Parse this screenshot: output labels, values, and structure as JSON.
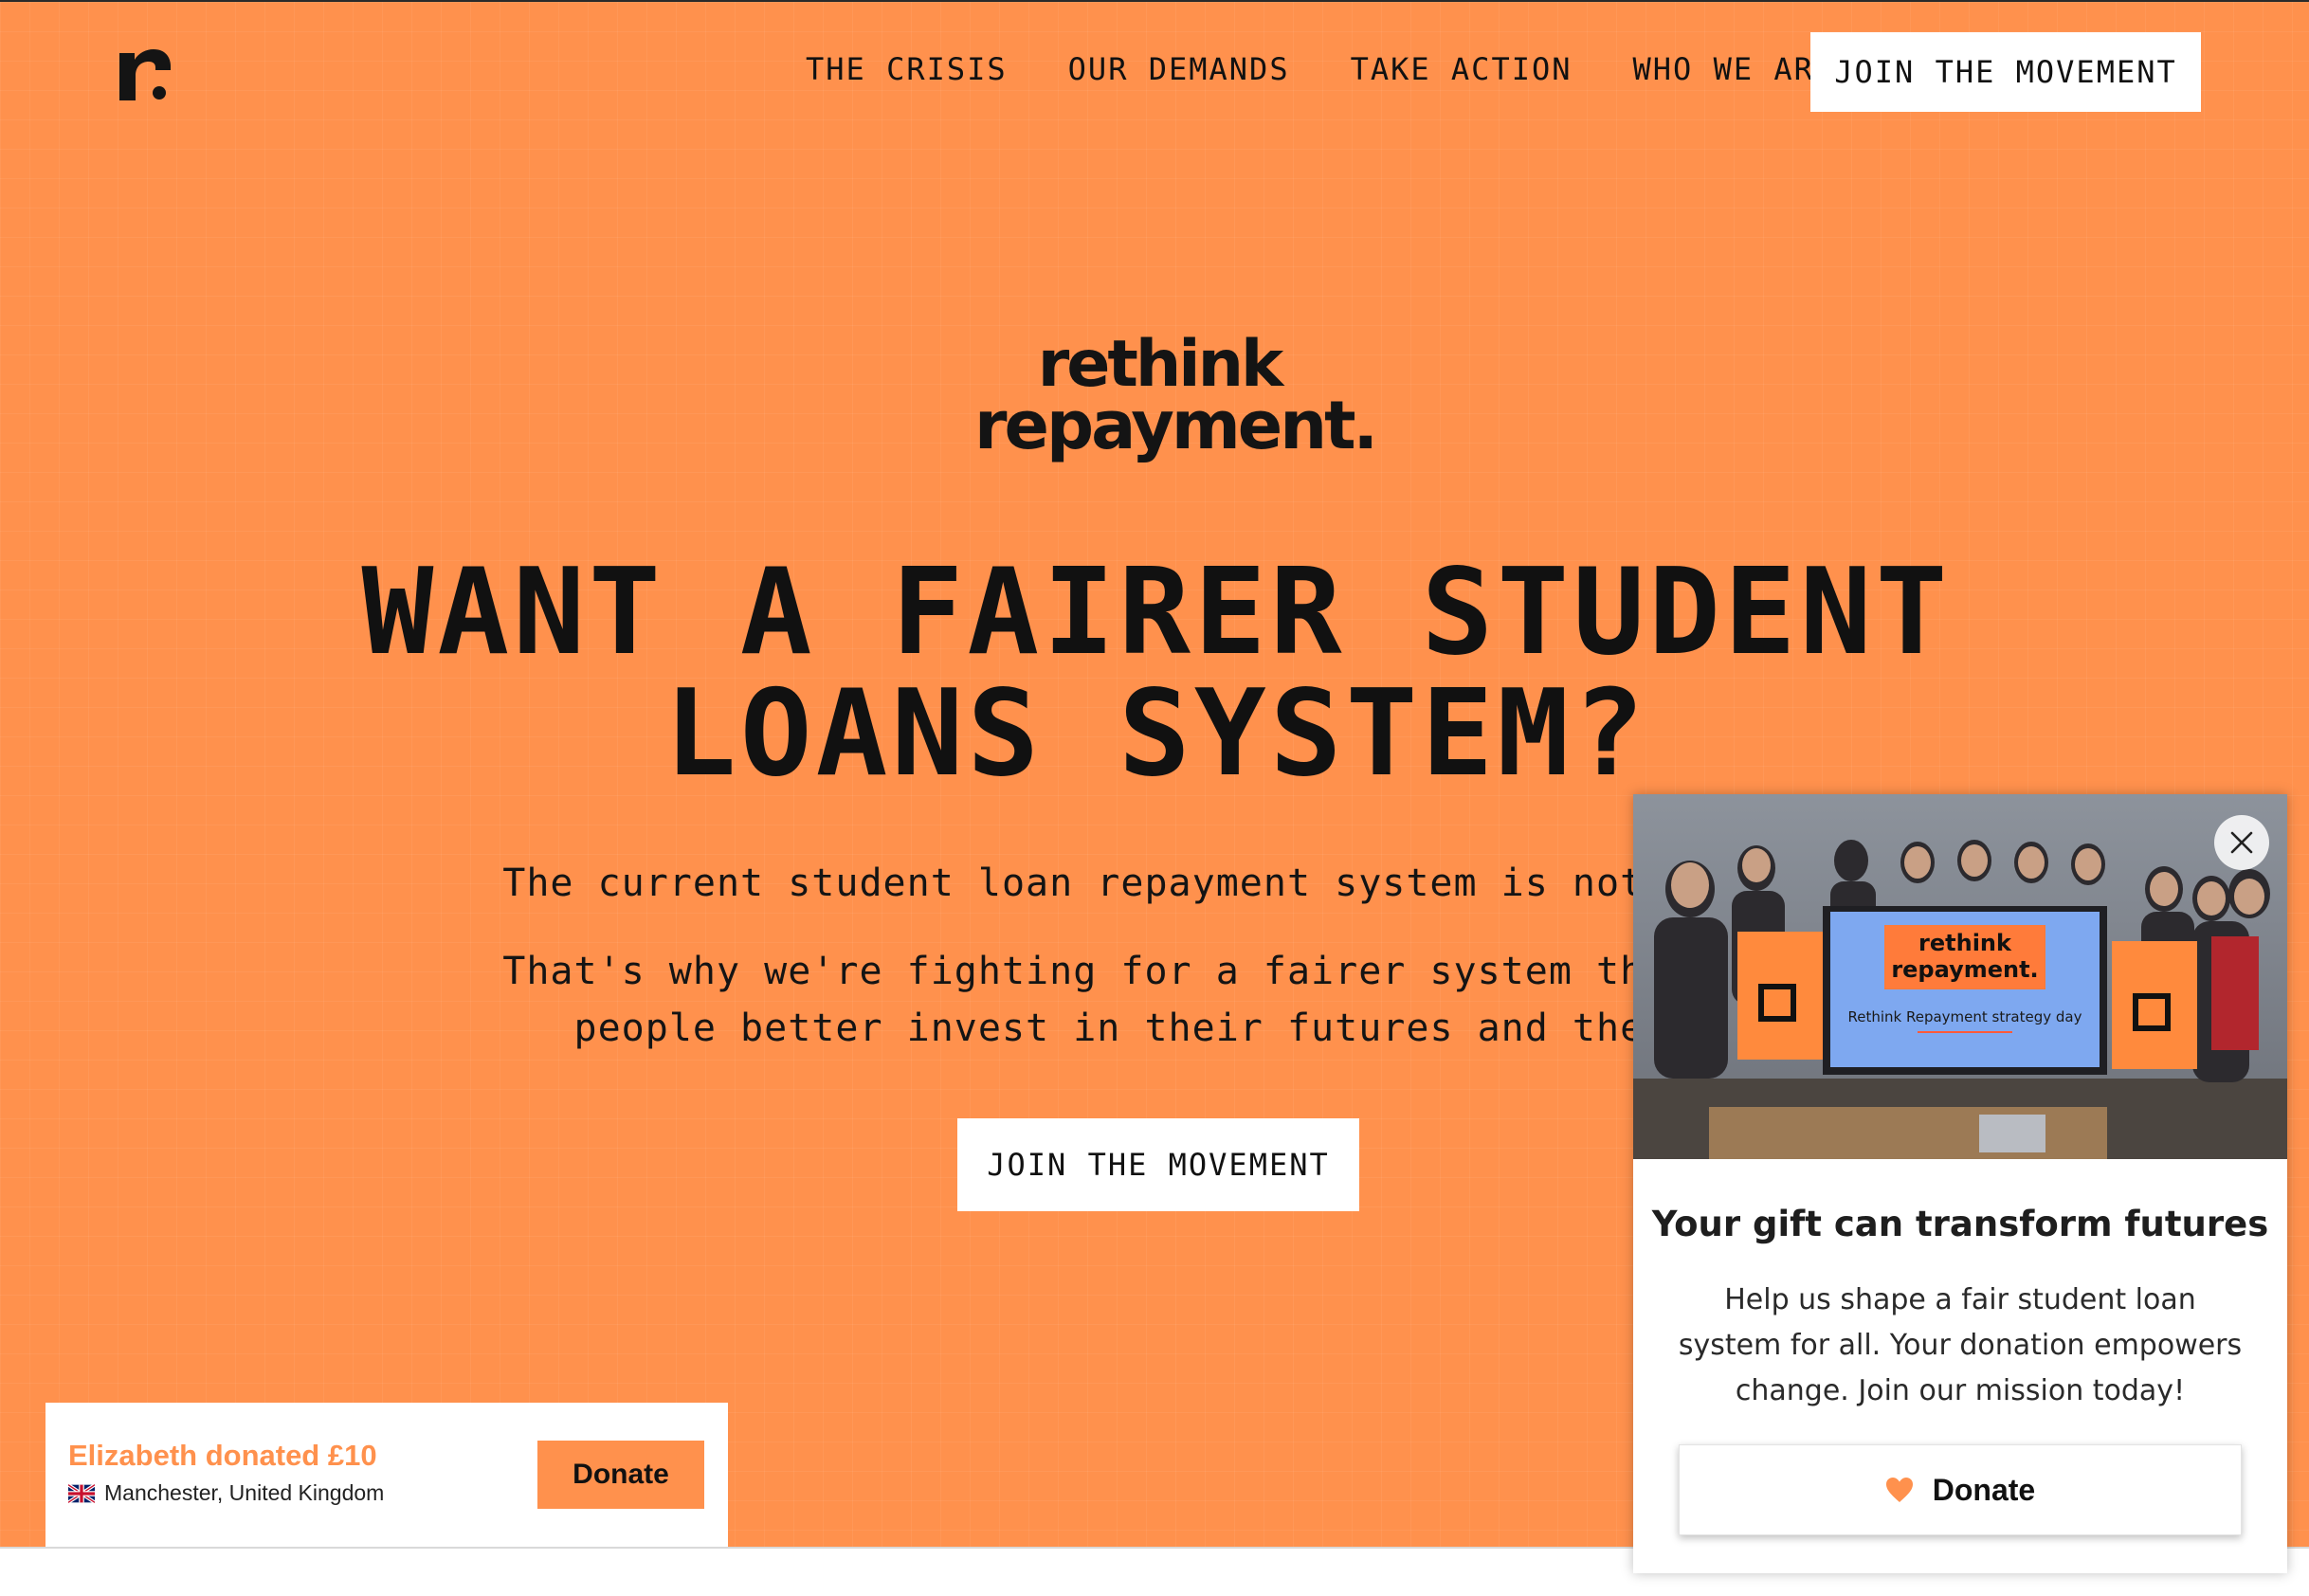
{
  "header": {
    "nav": [
      {
        "label": "THE CRISIS"
      },
      {
        "label": "OUR DEMANDS"
      },
      {
        "label": "TAKE ACTION"
      },
      {
        "label": "WHO WE ARE"
      }
    ],
    "cta_label": "JOIN THE MOVEMENT"
  },
  "hero": {
    "brand_line1": "rethink",
    "brand_line2": "repayment.",
    "headline_line1": "WANT A FAIRER STUDENT",
    "headline_line2": "LOANS SYSTEM?",
    "sub1": "The current student loan repayment system is not fit fo",
    "sub2_line1": "That's why we're fighting for a fairer system that will",
    "sub2_line2": "people better invest in their futures and the eco",
    "cta_label": "JOIN THE MOVEMENT"
  },
  "toast": {
    "title": "Elizabeth donated £10",
    "location": "Manchester, United Kingdom",
    "donate_label": "Donate"
  },
  "popup": {
    "photo_sign_line1": "rethink",
    "photo_sign_line2": "repayment.",
    "photo_screen_caption": "Rethink Repayment strategy day",
    "title": "Your gift can transform futures",
    "body": "Help us shape a fair student loan system for all. Your donation empowers change. Join our mission today!",
    "donate_label": "Donate"
  },
  "colors": {
    "brand_orange": "#ff914d",
    "text_dark": "#111111",
    "white": "#ffffff"
  },
  "icons": [
    "logo-mark-icon",
    "close-icon",
    "heart-icon",
    "uk-flag-icon"
  ]
}
